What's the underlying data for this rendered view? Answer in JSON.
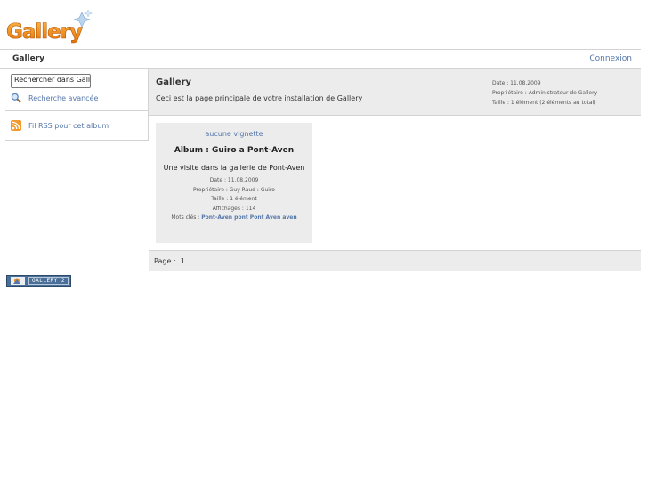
{
  "logo": {
    "text": "Gallery"
  },
  "header": {
    "breadcrumb": "Gallery",
    "login_label": "Connexion"
  },
  "sidebar": {
    "search_value": "Rechercher dans Galle",
    "advanced_search_label": "Recherche avancée",
    "rss_label": "Fil RSS pour cet album"
  },
  "album": {
    "title": "Gallery",
    "description": "Ceci est la page principale de votre installation de Gallery",
    "meta": {
      "date": "Date : 11.08.2009",
      "owner": "Propriétaire : Administrateur de Gallery",
      "size": "Taille : 1 élément (2 éléments au total)"
    }
  },
  "item": {
    "no_thumbnail_label": "aucune vignette",
    "title": "Album : Guiro a Pont-Aven",
    "description": "Une visite dans la gallerie de Pont-Aven",
    "date": "Date : 11.08.2009",
    "owner": "Propriétaire : Guy Raud : Guiro",
    "size": "Taille : 1 élément",
    "views": "Affichages : 114",
    "keywords_label": "Mots clés : ",
    "keywords": "Pont-Aven pont Pont Aven aven"
  },
  "pager": {
    "label": "Page :",
    "current": "1"
  },
  "footer": {
    "badge_text": "GALLERY 2"
  },
  "colors": {
    "link": "#5577aa",
    "panel": "#ececec",
    "logo_orange": "#f08a12",
    "border": "#d3d3d3"
  }
}
